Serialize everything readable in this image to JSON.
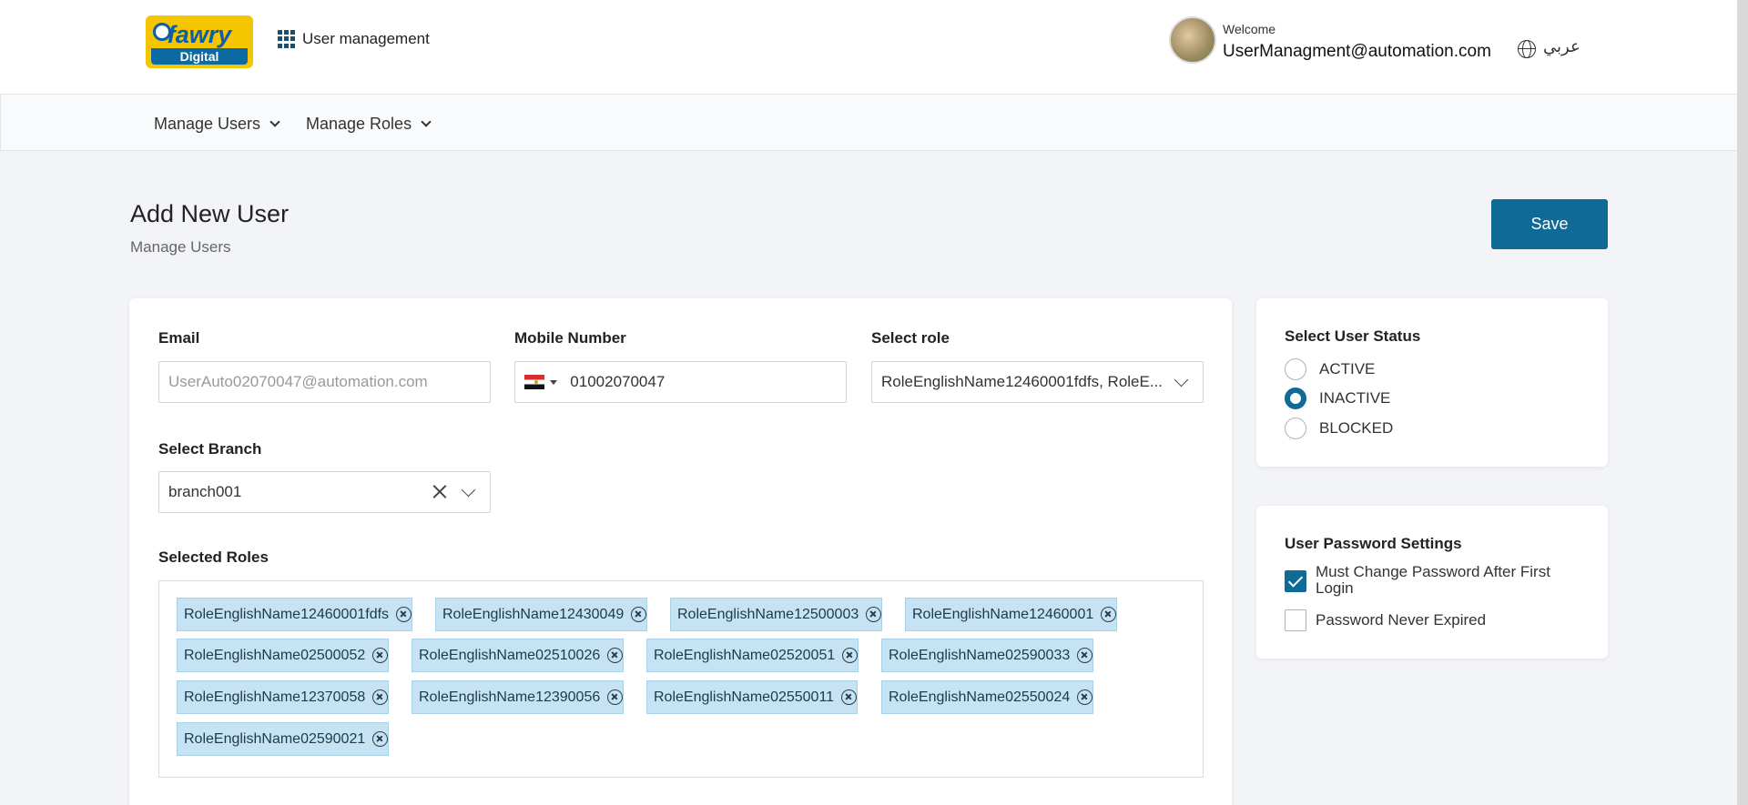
{
  "header": {
    "logo_text": "fawry",
    "logo_sub": "Digital",
    "app_title": "User management",
    "welcome": "Welcome",
    "user_email": "UserManagment@automation.com",
    "language": "عربي"
  },
  "nav": {
    "items": [
      {
        "label": "Manage Users"
      },
      {
        "label": "Manage Roles"
      }
    ]
  },
  "page": {
    "title": "Add New User",
    "breadcrumb": "Manage Users",
    "save_label": "Save"
  },
  "form": {
    "email_label": "Email",
    "email_placeholder": "UserAuto02070047@automation.com",
    "mobile_label": "Mobile Number",
    "mobile_value": "01002070047",
    "role_label": "Select role",
    "role_value": "RoleEnglishName12460001fdfs, RoleE...",
    "branch_label": "Select Branch",
    "branch_value": "branch001",
    "selected_roles_label": "Selected Roles",
    "selected_roles": [
      "RoleEnglishName12460001fdfs",
      "RoleEnglishName12430049",
      "RoleEnglishName12500003",
      "RoleEnglishName12460001",
      "RoleEnglishName02500052",
      "RoleEnglishName02510026",
      "RoleEnglishName02520051",
      "RoleEnglishName02590033",
      "RoleEnglishName12370058",
      "RoleEnglishName12390056",
      "RoleEnglishName02550011",
      "RoleEnglishName02550024",
      "RoleEnglishName02590021"
    ]
  },
  "status": {
    "title": "Select User Status",
    "options": [
      "ACTIVE",
      "INACTIVE",
      "BLOCKED"
    ],
    "selected": "INACTIVE"
  },
  "password": {
    "title": "User Password Settings",
    "must_change_label": "Must Change Password After First Login",
    "must_change_checked": true,
    "never_expired_label": "Password Never Expired",
    "never_expired_checked": false
  },
  "colors": {
    "primary": "#0f6a96",
    "chip_bg": "#c6e3f3",
    "logo_yellow": "#f5c500"
  }
}
